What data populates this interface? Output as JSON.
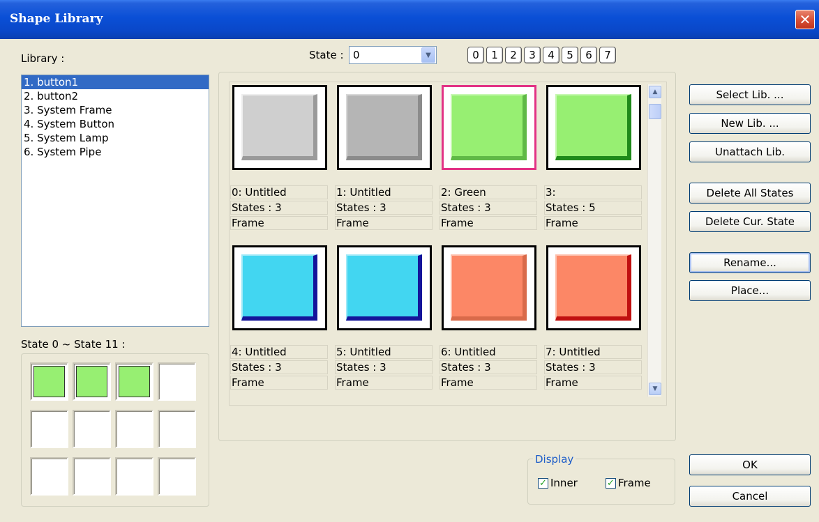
{
  "window": {
    "title": "Shape Library",
    "close_glyph": "✕"
  },
  "library": {
    "label": "Library :",
    "items": [
      "1. button1",
      "2. button2",
      "3. System Frame",
      "4. System Button",
      "5. System Lamp",
      "6. System Pipe"
    ],
    "selected_index": 0
  },
  "state": {
    "label": "State :",
    "value": "0",
    "buttons": [
      "0",
      "1",
      "2",
      "3",
      "4",
      "5",
      "6",
      "7"
    ]
  },
  "state_range": {
    "label": "State 0 ~ State 11 :",
    "filled_count": 3
  },
  "shapes": [
    {
      "name": "0: Untitled",
      "states": "States : 3",
      "type": "Frame"
    },
    {
      "name": "1: Untitled",
      "states": "States : 3",
      "type": "Frame"
    },
    {
      "name": "2: Green",
      "states": "States : 3",
      "type": "Frame"
    },
    {
      "name": "3:",
      "states": "States : 5",
      "type": "Frame"
    },
    {
      "name": "4: Untitled",
      "states": "States : 3",
      "type": "Frame"
    },
    {
      "name": "5: Untitled",
      "states": "States : 3",
      "type": "Frame"
    },
    {
      "name": "6: Untitled",
      "states": "States : 3",
      "type": "Frame"
    },
    {
      "name": "7: Untitled",
      "states": "States : 3",
      "type": "Frame"
    }
  ],
  "buttons": {
    "select_lib": "Select Lib. ...",
    "new_lib": "New Lib. ...",
    "unattach_lib": "Unattach Lib.",
    "delete_all_states": "Delete All States",
    "delete_cur_state": "Delete Cur. State",
    "rename": "Rename...",
    "place": "Place...",
    "ok": "OK",
    "cancel": "Cancel"
  },
  "display": {
    "label": "Display",
    "inner": "Inner",
    "frame": "Frame",
    "inner_checked": true,
    "frame_checked": true
  },
  "colors": {
    "accent_blue": "#316ac5",
    "green": "#97ef72",
    "cyan": "#42d6f1",
    "salmon": "#fc8766",
    "gray": "#cfcfcf"
  }
}
